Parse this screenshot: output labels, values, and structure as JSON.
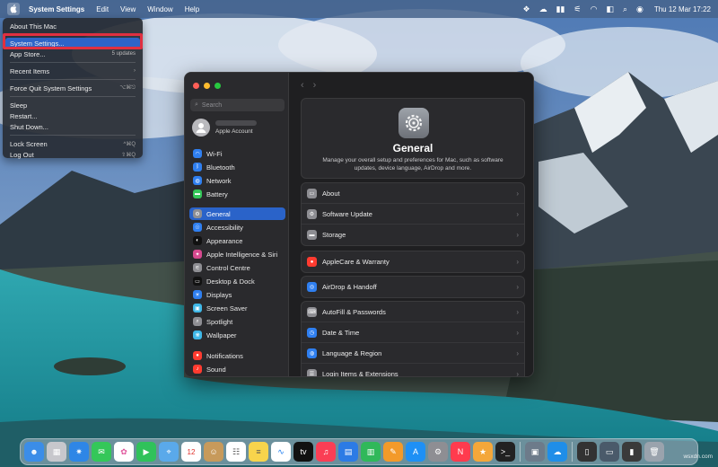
{
  "menubar": {
    "app_name": "System Settings",
    "items": [
      "Edit",
      "View",
      "Window",
      "Help"
    ],
    "clock": "Thu 12 Mar  17:22"
  },
  "apple_menu": {
    "about": "About This Mac",
    "system_settings": "System Settings...",
    "app_store": "App Store...",
    "app_store_badge": "5 updates",
    "recent_items": "Recent Items",
    "force_quit": "Force Quit System Settings",
    "force_quit_shortcut": "⌥⌘⎋",
    "sleep": "Sleep",
    "restart": "Restart...",
    "shut_down": "Shut Down...",
    "lock_screen": "Lock Screen",
    "lock_screen_shortcut": "^⌘Q",
    "log_out": "Log Out",
    "log_out_shortcut": "⇧⌘Q"
  },
  "sidebar": {
    "search_placeholder": "Search",
    "account_label": "Apple Account",
    "items": [
      {
        "label": "Wi-Fi",
        "icon": "wifi-icon",
        "color": "#2f7ff0"
      },
      {
        "label": "Bluetooth",
        "icon": "bluetooth-icon",
        "color": "#2f7ff0"
      },
      {
        "label": "Network",
        "icon": "globe-icon",
        "color": "#2f7ff0"
      },
      {
        "label": "Battery",
        "icon": "battery-icon",
        "color": "#34c759"
      },
      {
        "label": "General",
        "icon": "gear-icon",
        "color": "#8e8e93"
      },
      {
        "label": "Accessibility",
        "icon": "accessibility-icon",
        "color": "#2f7ff0"
      },
      {
        "label": "Appearance",
        "icon": "appearance-icon",
        "color": "#111111"
      },
      {
        "label": "Apple Intelligence & Siri",
        "icon": "siri-icon",
        "color": "#d6498f"
      },
      {
        "label": "Control Centre",
        "icon": "control-centre-icon",
        "color": "#8e8e93"
      },
      {
        "label": "Desktop & Dock",
        "icon": "dock-icon",
        "color": "#111111"
      },
      {
        "label": "Displays",
        "icon": "displays-icon",
        "color": "#2f7ff0"
      },
      {
        "label": "Screen Saver",
        "icon": "screen-saver-icon",
        "color": "#3fb8e8"
      },
      {
        "label": "Spotlight",
        "icon": "spotlight-icon",
        "color": "#8e8e93"
      },
      {
        "label": "Wallpaper",
        "icon": "wallpaper-icon",
        "color": "#3fb8e8"
      },
      {
        "label": "Notifications",
        "icon": "notifications-icon",
        "color": "#ff3b30"
      },
      {
        "label": "Sound",
        "icon": "sound-icon",
        "color": "#ff3b30"
      }
    ]
  },
  "main": {
    "title": "General",
    "description": "Manage your overall setup and preferences for Mac, such as software updates, device language, AirDrop and more.",
    "group1": [
      "About",
      "Software Update",
      "Storage"
    ],
    "group2": [
      "AppleCare & Warranty"
    ],
    "group3": [
      "AirDrop & Handoff"
    ],
    "group4": [
      "AutoFill & Passwords",
      "Date & Time",
      "Language & Region",
      "Login Items & Extensions"
    ]
  },
  "watermark": "wsxdn.com",
  "colors": {
    "accent": "#2a63c9",
    "highlight_box": "#e03040"
  }
}
